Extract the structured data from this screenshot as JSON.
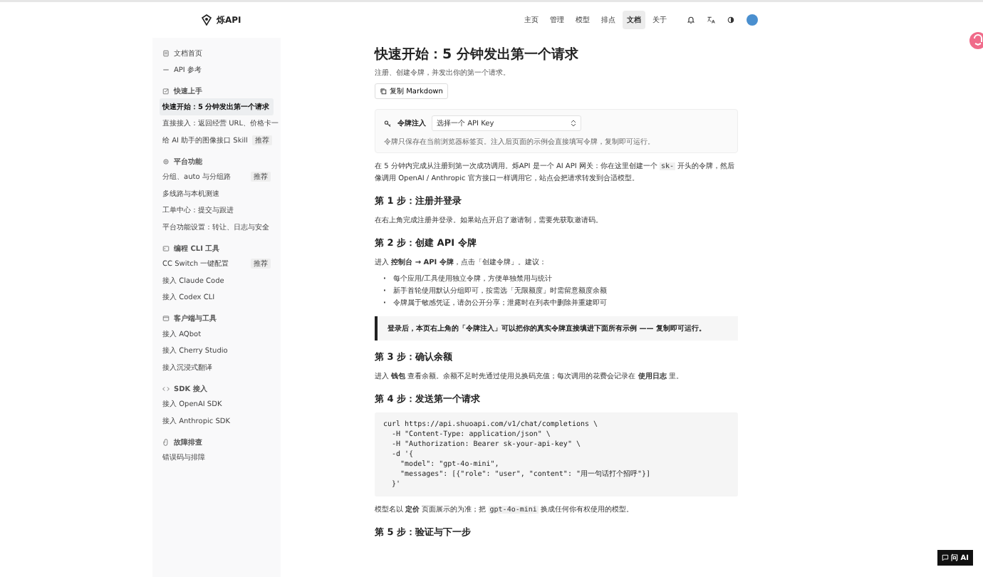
{
  "header": {
    "logo": "烁API",
    "nav": [
      {
        "label": "主页",
        "selected": false
      },
      {
        "label": "管理",
        "selected": false
      },
      {
        "label": "模型",
        "selected": false
      },
      {
        "label": "排点",
        "selected": false
      },
      {
        "label": "文档",
        "selected": true
      },
      {
        "label": "关于",
        "selected": false
      }
    ]
  },
  "sidebar": {
    "items": [
      {
        "kind": "page",
        "label": "文档首页",
        "selected": false
      },
      {
        "kind": "page",
        "label": "API 参考",
        "selected": false
      },
      {
        "kind": "section",
        "label": "快速上手"
      },
      {
        "kind": "item",
        "label": "快速开始：5 分钟发出第一个请求",
        "selected": true
      },
      {
        "kind": "item",
        "label": "直接接入：返回经营 URL、价格卡一",
        "selected": false
      },
      {
        "kind": "item",
        "label": "给 AI 助手的图像接口 Skill",
        "badge": "推荐",
        "selected": false
      },
      {
        "kind": "section",
        "label": "平台功能"
      },
      {
        "kind": "item",
        "label": "分组、auto 与分组路",
        "badge": "推荐",
        "selected": false
      },
      {
        "kind": "item",
        "label": "多线路与本机测速",
        "selected": false
      },
      {
        "kind": "item",
        "label": "工单中心：提交与跟进",
        "selected": false
      },
      {
        "kind": "item",
        "label": "平台功能设置：转让、日志与安全",
        "selected": false
      },
      {
        "kind": "section",
        "label": "编程 CLI 工具"
      },
      {
        "kind": "item",
        "label": "CC Switch 一键配置",
        "badge": "推荐",
        "selected": false
      },
      {
        "kind": "item",
        "label": "接入 Claude Code",
        "selected": false
      },
      {
        "kind": "item",
        "label": "接入 Codex CLI",
        "selected": false
      },
      {
        "kind": "section",
        "label": "客户端与工具"
      },
      {
        "kind": "item",
        "label": "接入 AQbot",
        "selected": false
      },
      {
        "kind": "item",
        "label": "接入 Cherry Studio",
        "selected": false
      },
      {
        "kind": "item",
        "label": "接入沉浸式翻译",
        "selected": false
      },
      {
        "kind": "section",
        "label": "SDK 接入"
      },
      {
        "kind": "item",
        "label": "接入 OpenAI SDK",
        "selected": false
      },
      {
        "kind": "item",
        "label": "接入 Anthropic SDK",
        "selected": false
      },
      {
        "kind": "section",
        "label": "故障排查"
      },
      {
        "kind": "item",
        "label": "错误码与排障",
        "selected": false
      }
    ]
  },
  "main": {
    "title": "快速开始：5 分钟发出第一个请求",
    "subtitle": "注册、创建令牌，并发出你的第一个请求。",
    "copy_button": "复制 Markdown",
    "token_panel": {
      "label": "令牌注入",
      "select_placeholder": "选择一个 API Key",
      "note": "令牌只保存在当前浏览器标签页。注入后页面的示例会直接填写令牌，复制即可运行。"
    },
    "blocks": [
      {
        "kind": "p",
        "parts": [
          {
            "kind": "text",
            "text": "在 5 分钟内完成从注册到第一次成功调用。烁API 是一个 AI API 网关：你在这里创建一个 "
          },
          {
            "kind": "code",
            "text": "sk-"
          },
          {
            "kind": "text",
            "text": " 开头的令牌，然后像调用 OpenAI / Anthropic 官方接口一样调用它，站点会把请求转发到合适模型。"
          }
        ]
      },
      {
        "kind": "h2",
        "text": "第 1 步：注册并登录"
      },
      {
        "kind": "p",
        "parts": [
          {
            "kind": "text",
            "text": "在右上角完成注册并登录。如果站点开启了邀请制，需要先获取邀请码。"
          }
        ]
      },
      {
        "kind": "h2",
        "text": "第 2 步：创建 API 令牌"
      },
      {
        "kind": "p",
        "parts": [
          {
            "kind": "text",
            "text": "进入 **控制台 → API 令牌**，点击「创建令牌」。建议："
          }
        ]
      },
      {
        "kind": "list",
        "items": [
          {
            "marker": "·",
            "text": "每个应用/工具使用独立令牌，方便单独禁用与统计"
          },
          {
            "marker": "·",
            "text": "新手首轮使用默认分组即可，按需选「无限额度」时需留意额度余额"
          },
          {
            "marker": "·",
            "text": "令牌属于敏感凭证，请勿公开分享；泄露时在列表中删除并重建即可"
          }
        ]
      },
      {
        "kind": "callout",
        "text": "登录后，本页右上角的「令牌注入」可以把你的真实令牌直接填进下面所有示例 —— 复制即可运行。"
      },
      {
        "kind": "h2",
        "text": "第 3 步：确认余额"
      },
      {
        "kind": "p",
        "parts": [
          {
            "kind": "text",
            "text": "进入 **钱包** 查看余额。余额不足时先通过使用兑换码充值；每次调用的花费会记录在 **使用日志** 里。"
          }
        ]
      },
      {
        "kind": "h2",
        "text": "第 4 步：发送第一个请求"
      },
      {
        "kind": "code",
        "lines": [
          "curl https://api.shuoapi.com/v1/chat/completions \\",
          "  -H \"Content-Type: application/json\" \\",
          "  -H \"Authorization: Bearer sk-your-api-key\" \\",
          "  -d '{",
          "    \"model\": \"gpt-4o-mini\",",
          "    \"messages\": [{\"role\": \"user\", \"content\": \"用一句话打个招呼\"}]",
          "  }'"
        ]
      },
      {
        "kind": "p",
        "parts": [
          {
            "kind": "text",
            "text": "模型名以 **定价** 页面展示的为准；把 "
          },
          {
            "kind": "code",
            "text": "gpt-4o-mini"
          },
          {
            "kind": "text",
            "text": " 换成任何你有权使用的模型。"
          }
        ]
      },
      {
        "kind": "h2",
        "text": "第 5 步：验证与下一步"
      }
    ]
  },
  "ask_button": "问 AI"
}
